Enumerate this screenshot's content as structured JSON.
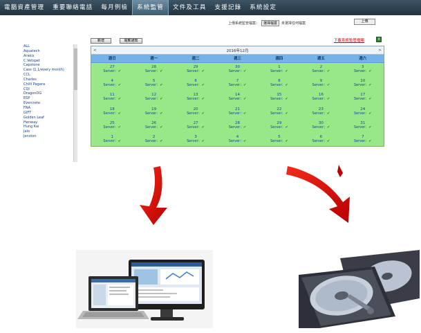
{
  "nav": {
    "tabs": [
      {
        "label": "電腦資產管理",
        "active": false
      },
      {
        "label": "重要聯絡電話",
        "active": false
      },
      {
        "label": "每月例檢",
        "active": false
      },
      {
        "label": "系統監管",
        "active": true
      },
      {
        "label": "文件及工具",
        "active": false
      },
      {
        "label": "支援記錄",
        "active": false
      },
      {
        "label": "系統設定",
        "active": false
      }
    ]
  },
  "upload": {
    "label": "上傳系統監管檔案：",
    "file_button": "選擇檔案",
    "file_status": "未選擇任何檔案",
    "submit": "上傳"
  },
  "toolbar": {
    "add_label": "新增",
    "email_label": "電郵通知",
    "download_label": "下載系統監管檔案"
  },
  "sidebar": {
    "items": [
      "ALL",
      "Aquatech",
      "Arakis",
      "C.Vetspet",
      "Capstone",
      "Cass (1,1/every month)",
      "CCL",
      "Charles",
      "Chilli Pagara",
      "CQI",
      "DragonDG",
      "ESP",
      "Evercrete",
      "FNA",
      "GIFT",
      "Golden Leaf",
      "Henway",
      "Hung Kai",
      "Jalo",
      "Jenston"
    ]
  },
  "calendar": {
    "month_label": "2016年12月",
    "prev": "<",
    "next": ">",
    "weekdays": [
      "週日",
      "週一",
      "週二",
      "週三",
      "週四",
      "週五",
      "週六"
    ],
    "server_label": "Server：",
    "check": "✔",
    "days": [
      27,
      28,
      29,
      30,
      1,
      2,
      3,
      4,
      5,
      6,
      7,
      8,
      9,
      10,
      11,
      12,
      13,
      14,
      15,
      16,
      17,
      18,
      19,
      20,
      21,
      22,
      23,
      24,
      25,
      26,
      27,
      28,
      29,
      30,
      31,
      1,
      2,
      3,
      4,
      5,
      6,
      7
    ]
  },
  "colors": {
    "nav_bg": "#2b3f4d",
    "calendar_green": "#98e888",
    "weekday_blue": "#75b3e6",
    "arrow_red": "#e01010"
  },
  "images": {
    "left": "laptop-and-monitor-illustration",
    "right": "hard-disk-drives-photo"
  }
}
